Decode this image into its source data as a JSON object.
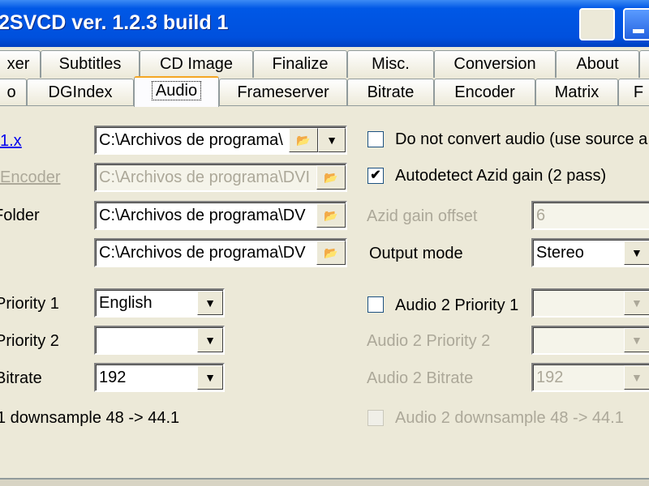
{
  "window": {
    "title": "2SVCD ver. 1.2.3 build 1"
  },
  "tabs_row1": [
    "xer",
    "Subtitles",
    "CD Image",
    "Finalize",
    "Misc.",
    "Conversion",
    "About",
    ""
  ],
  "tabs_row2": [
    "o",
    "DGIndex",
    "Audio",
    "Frameserver",
    "Bitrate",
    "Encoder",
    "Matrix",
    "F"
  ],
  "selected_tab": "Audio",
  "left": {
    "encoder_link": "1.x",
    "encoder_path": "C:\\Archivos de programa\\",
    "encoder2_link": " Encoder",
    "encoder2_path": "C:\\Archivos de programa\\DVI",
    "folder_label": "Folder",
    "folder_path": "C:\\Archivos de programa\\DV",
    "path4": "C:\\Archivos de programa\\DV",
    "priority1_label": "Priority 1",
    "priority1_value": "English",
    "priority2_label": "Priority 2",
    "priority2_value": "",
    "bitrate_label": "Bitrate",
    "bitrate_value": "192",
    "downsample_label": "1 downsample 48 -> 44.1"
  },
  "right": {
    "no_convert_label": "Do not convert audio (use source a",
    "no_convert_checked": false,
    "autodetect_label": "Autodetect Azid gain (2 pass)",
    "autodetect_checked": true,
    "azid_offset_label": "Azid gain offset",
    "azid_offset_value": "6",
    "output_mode_label": "Output mode",
    "output_mode_value": "Stereo",
    "audio2_priority1_label": "Audio 2 Priority 1",
    "audio2_priority1_checked": false,
    "audio2_priority1_value": "",
    "audio2_priority2_label": "Audio 2 Priority 2",
    "audio2_priority2_value": "",
    "audio2_bitrate_label": "Audio 2 Bitrate",
    "audio2_bitrate_value": "192",
    "audio2_downsample_label": "Audio 2 downsample 48 -> 44.1"
  },
  "icons": {
    "check": "✔",
    "dropdown": "▼",
    "folder": "📂"
  }
}
